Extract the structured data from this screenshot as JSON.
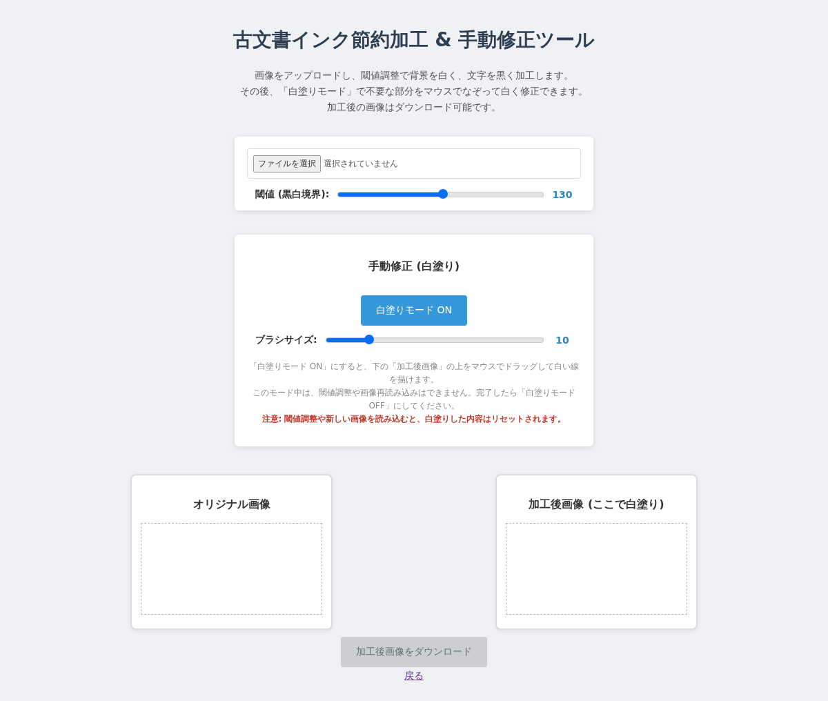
{
  "title": "古文書インク節約加工 & 手動修正ツール",
  "description": [
    "画像をアップロードし、閾値調整で背景を白く、文字を黒く加工します。",
    "その後、「白塗りモード」で不要な部分をマウスでなぞって白く修正できます。",
    "加工後の画像はダウンロード可能です。"
  ],
  "file_input": {
    "button": "ファイルを選択",
    "status": "選択されていません"
  },
  "threshold": {
    "label": "閾値 (黒白境界):",
    "level": 0.51,
    "reading": "130"
  },
  "manual": {
    "title": "手動修正 (白塗り)",
    "mode_button": "白塗りモード ON",
    "brush": {
      "label": "ブラシサイズ:",
      "level": 0.2,
      "reading": "10"
    },
    "notes": [
      "「白塗りモード ON」にすると、下の「加工後画像」の上をマウスでドラッグして白い線を描けます。",
      "このモード中は、閾値調整や画像再読み込みはできません。完了したら「白塗りモード OFF」にしてください。"
    ],
    "warning": "注意: 閾値調整や新しい画像を読み込むと、白塗りした内容はリセットされます。"
  },
  "image_panels": [
    {
      "title": "オリジナル画像"
    },
    {
      "title": "加工後画像 (ここで白塗り)"
    }
  ],
  "download_button": {
    "label": "加工後画像をダウンロード",
    "disabled": true
  },
  "back_link": "戻る"
}
